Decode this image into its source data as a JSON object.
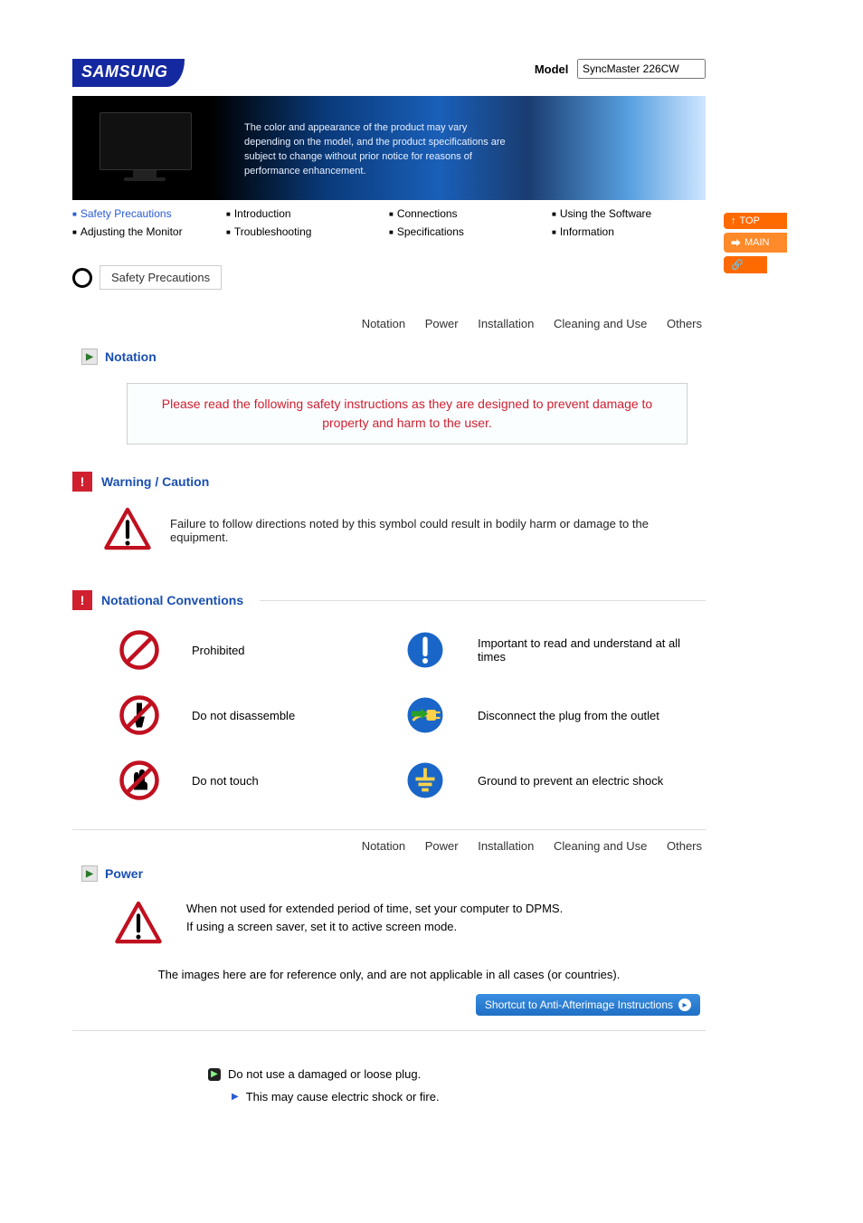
{
  "brand": "SAMSUNG",
  "model": {
    "label": "Model",
    "value": "SyncMaster 226CW"
  },
  "hero": {
    "text": "The color and appearance of the product may vary depending on the model, and the product specifica­tions are subject to change without prior notice for reasons of performance enhancement."
  },
  "nav": {
    "row1": [
      "Safety Precautions",
      "Introduction",
      "Connections",
      "Using the Software"
    ],
    "row2": [
      "Adjusting the Monitor",
      "Troubleshooting",
      "Specifications",
      "Information"
    ]
  },
  "side_tabs": {
    "top": "TOP",
    "main": "MAIN",
    "bookmark": ""
  },
  "section_tab": "Safety Precautions",
  "subnav": [
    "Notation",
    "Power",
    "Installation",
    "Cleaning and Use",
    "Others"
  ],
  "notation": {
    "heading": "Notation",
    "banner": "Please read the following safety instructions as they are designed to prevent damage to property and harm to the user."
  },
  "warning": {
    "heading": "Warning / Caution",
    "text": "Failure to follow directions noted by this symbol could result in bodily harm or damage to the equipment."
  },
  "conventions": {
    "heading": "Notational Conventions",
    "items": [
      {
        "icon": "prohibited-icon",
        "label": "Prohibited"
      },
      {
        "icon": "important-icon",
        "label": "Important to read and understand at all times"
      },
      {
        "icon": "disassemble-icon",
        "label": "Do not disassemble"
      },
      {
        "icon": "unplug-icon",
        "label": "Disconnect the plug from the outlet"
      },
      {
        "icon": "notouch-icon",
        "label": "Do not touch"
      },
      {
        "icon": "ground-icon",
        "label": "Ground to prevent an electric shock"
      }
    ]
  },
  "power": {
    "heading": "Power",
    "intro1": "When not used for extended period of time, set your computer to DPMS.",
    "intro2": "If using a screen saver, set it to active screen mode.",
    "ref_note": "The images here are for reference only, and are not applicable in all cases (or countries).",
    "shortcut": "Shortcut to Anti-Afterimage Instructions",
    "tip1": "Do not use a damaged or loose plug.",
    "tip2": "This may cause electric shock or fire."
  }
}
